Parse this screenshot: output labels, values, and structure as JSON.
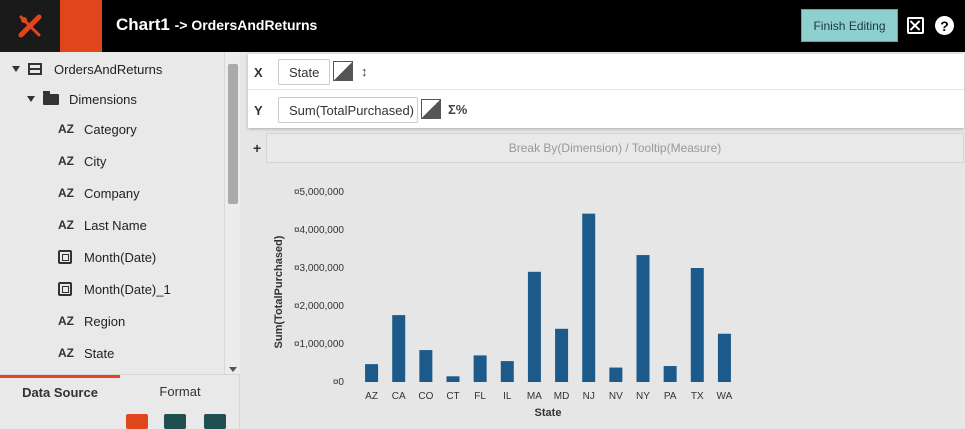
{
  "header": {
    "chart_name": "Chart1",
    "breadcrumb": "-> OrdersAndReturns",
    "finish_label": "Finish Editing",
    "help_label": "?"
  },
  "sidebar": {
    "datasource": "OrdersAndReturns",
    "group": "Dimensions",
    "items": [
      {
        "type": "AZ",
        "label": "Category"
      },
      {
        "type": "AZ",
        "label": "City"
      },
      {
        "type": "AZ",
        "label": "Company"
      },
      {
        "type": "AZ",
        "label": "Last Name"
      },
      {
        "type": "date",
        "label": "Month(Date)"
      },
      {
        "type": "date",
        "label": "Month(Date)_1"
      },
      {
        "type": "AZ",
        "label": "Region"
      },
      {
        "type": "AZ",
        "label": "State"
      }
    ],
    "tabs": {
      "data_source": "Data Source",
      "format": "Format"
    }
  },
  "axes": {
    "x_letter": "X",
    "x_field": "State",
    "y_letter": "Y",
    "y_field": "Sum(TotalPurchased)",
    "sort_symbol": "↕",
    "agg_symbol": "Σ%",
    "plus": "+",
    "breakby": "Break By(Dimension) / Tooltip(Measure)"
  },
  "chart_data": {
    "type": "bar",
    "categories": [
      "AZ",
      "CA",
      "CO",
      "CT",
      "FL",
      "IL",
      "MA",
      "MD",
      "NJ",
      "NV",
      "NY",
      "PA",
      "TX",
      "WA"
    ],
    "values": [
      470000,
      1760000,
      840000,
      150000,
      700000,
      550000,
      2900000,
      1400000,
      4430000,
      380000,
      3340000,
      420000,
      3000000,
      1270000
    ],
    "ylim": [
      0,
      5000000
    ],
    "yticks": [
      "¤0",
      "¤1,000,000",
      "¤2,000,000",
      "¤3,000,000",
      "¤4,000,000",
      "¤5,000,000"
    ],
    "xlabel": "State",
    "ylabel": "Sum(TotalPurchased)",
    "color": "#1b5a8b"
  },
  "colors": {
    "accent": "#e0461b",
    "finish_button": "#8ecfcf",
    "bar": "#1b5a8b"
  }
}
